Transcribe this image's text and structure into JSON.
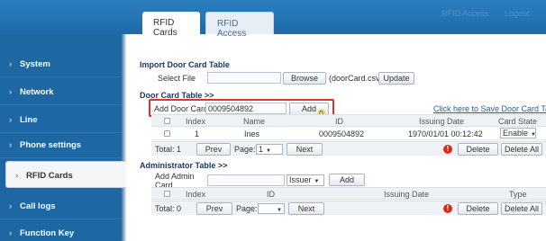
{
  "header": {
    "tabs": [
      {
        "label": "RFID Cards",
        "active": true
      },
      {
        "label": "RFID Access",
        "active": false
      }
    ],
    "ghost_left": "",
    "ghost_right_1": "RFID Access",
    "ghost_right_2": "Logout"
  },
  "sidebar": {
    "items": [
      {
        "label": "System"
      },
      {
        "label": "Network"
      },
      {
        "label": "Line"
      },
      {
        "label": "Phone settings"
      },
      {
        "label": "RFID Cards",
        "active": true
      },
      {
        "label": "Call logs"
      },
      {
        "label": "Function Key"
      }
    ]
  },
  "import_section": {
    "title": "Import Door Card Table",
    "select_file_label": "Select File",
    "browse_label": "Browse",
    "file_hint": "(doorCard.csv)",
    "update_label": "Update"
  },
  "door_card_table": {
    "title": "Door Card Table >>",
    "add_label": "Add Door Card",
    "add_value": "0009504892",
    "add_button": "Add",
    "save_link": "Click here to Save Door Card Table",
    "columns": [
      "Index",
      "Name",
      "ID",
      "Issuing Date",
      "Card State"
    ],
    "rows": [
      {
        "index": "1",
        "name": "Ines",
        "id": "0009504892",
        "date": "1970/01/01 00:12:42",
        "state": "Enable"
      }
    ],
    "footer": {
      "total": "Total: 1",
      "prev": "Prev",
      "page_label": "Page:",
      "page_value": "1",
      "next": "Next",
      "delete": "Delete",
      "delete_all": "Delete All"
    }
  },
  "admin_table": {
    "title": "Administrator Table >>",
    "add_label": "Add Admin Card",
    "add_value": "",
    "issuer_select": "Issuer",
    "add_button": "Add",
    "columns": [
      "Index",
      "ID",
      "Issuing Date",
      "Type"
    ],
    "footer": {
      "total": "Total: 0",
      "prev": "Prev",
      "page_label": "Page:",
      "page_value": "",
      "next": "Next",
      "delete": "Delete",
      "delete_all": "Delete All"
    }
  },
  "colors": {
    "brand_blue": "#1d67a3",
    "highlight_red": "#e0332a",
    "link_blue": "#1f5fb0"
  }
}
